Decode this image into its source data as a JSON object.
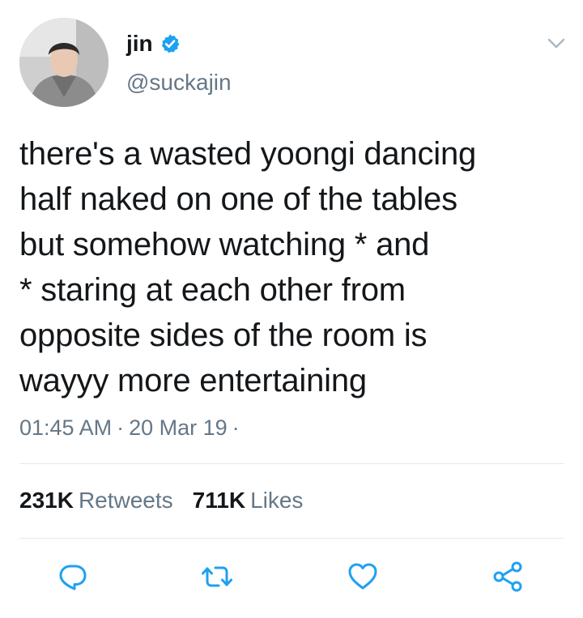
{
  "author": {
    "display_name": "jin",
    "handle": "@suckajin",
    "verified": true,
    "verified_color": "#1da1f2"
  },
  "tweet": {
    "text": "there's a wasted yoongi dancing\nhalf naked on one of the tables\nbut somehow watching * and\n* staring at each other from\nopposite sides of the room is\nwayyy more entertaining",
    "time": "01:45 AM",
    "date": "20 Mar 19",
    "separator": "·"
  },
  "stats": {
    "retweets_count": "231K",
    "retweets_label": "Retweets",
    "likes_count": "711K",
    "likes_label": "Likes"
  },
  "actions": {
    "icons": [
      "reply-icon",
      "retweet-icon",
      "like-icon",
      "share-icon"
    ],
    "icon_color": "#1da1f2"
  },
  "colors": {
    "text": "#14171a",
    "secondary": "#657786",
    "divider": "#e1e8ed",
    "accent": "#1da1f2"
  }
}
